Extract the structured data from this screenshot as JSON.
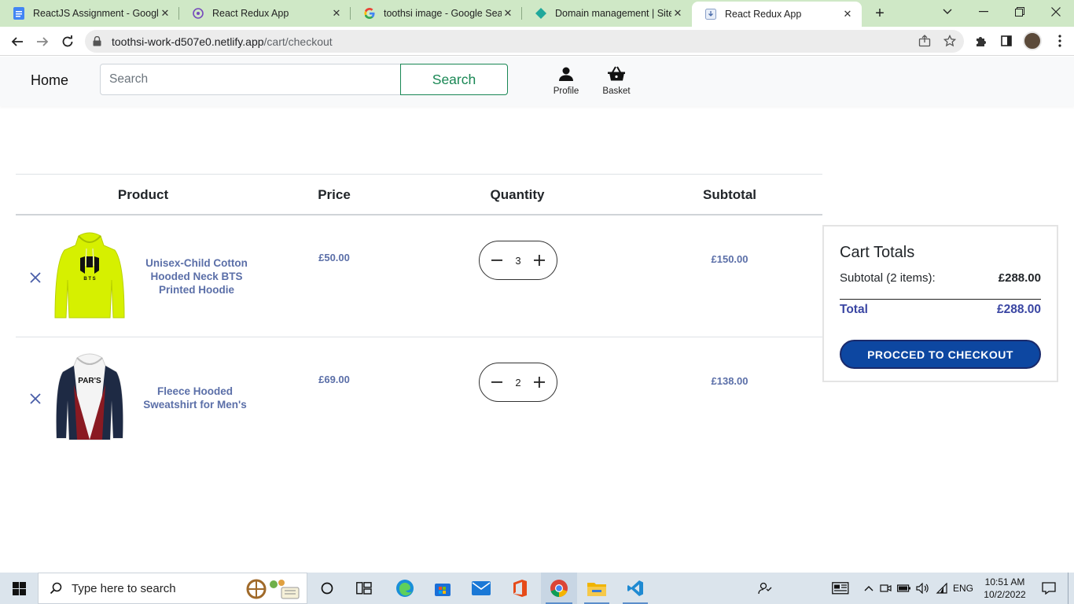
{
  "browser": {
    "tabs": [
      {
        "title": "ReactJS Assignment - Google Docs",
        "icon": "google-docs-icon"
      },
      {
        "title": "React Redux App",
        "icon": "redux-icon"
      },
      {
        "title": "toothsi image - Google Search",
        "icon": "google-icon"
      },
      {
        "title": "Domain management | Site settings",
        "icon": "netlify-icon"
      },
      {
        "title": "React Redux App",
        "icon": "download-icon",
        "active": true
      }
    ],
    "url_host": "toothsi-work-d507e0.netlify.app",
    "url_path": "/cart/checkout"
  },
  "nav": {
    "brand": "Home",
    "search_placeholder": "Search",
    "search_button": "Search",
    "profile_label": "Profile",
    "basket_label": "Basket"
  },
  "cart": {
    "headers": {
      "product": "Product",
      "price": "Price",
      "quantity": "Quantity",
      "subtotal": "Subtotal"
    },
    "items": [
      {
        "name": "Unisex-Child Cotton Hooded Neck BTS Printed Hoodie",
        "price": "£50.00",
        "quantity": "3",
        "subtotal": "£150.00",
        "image": "yellow-bts-hoodie"
      },
      {
        "name": "Fleece Hooded Sweatshirt for Men's",
        "price": "£69.00",
        "quantity": "2",
        "subtotal": "£138.00",
        "image": "paris-sweatshirt"
      }
    ]
  },
  "totals": {
    "title": "Cart Totals",
    "subtotal_label": "Subtotal (2 items):",
    "subtotal_value": "£288.00",
    "total_label": "Total",
    "total_value": "£288.00",
    "checkout_button": "PROCCED TO CHECKOUT"
  },
  "taskbar": {
    "search_placeholder": "Type here to search",
    "language": "ENG",
    "time": "10:51 AM",
    "date": "10/2/2022"
  },
  "colors": {
    "link_blue": "#5b6fa8",
    "total_blue": "#3a46a3",
    "checkout_bg": "#0d47a1",
    "search_green": "#198754",
    "tab_strip": "#cfe8c6"
  }
}
